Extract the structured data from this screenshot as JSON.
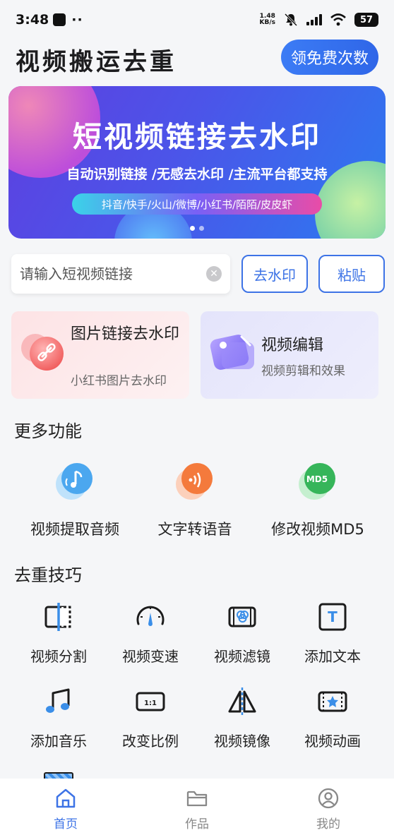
{
  "status_bar": {
    "time": "3:48",
    "dots": "··",
    "net_speed_top": "1.48",
    "net_speed_bottom": "KB/s",
    "battery": "57"
  },
  "header": {
    "title": "视频搬运去重",
    "free_button": "领免费次数"
  },
  "banner": {
    "title": "短视频链接去水印",
    "subtitle": "自动识别链接 /无感去水印 /主流平台都支持",
    "platforms": "抖音/快手/火山/微博/小红书/陌陌/皮皮虾",
    "active_dot": 1
  },
  "search": {
    "placeholder": "请输入短视频链接",
    "value": "",
    "dewater_button": "去水印",
    "paste_button": "粘贴"
  },
  "cards": [
    {
      "title": "图片链接去水印",
      "subtitle": "小红书图片去水印",
      "icon": "link-icon"
    },
    {
      "title": "视频编辑",
      "subtitle": "视频剪辑和效果",
      "icon": "video-edit-icon"
    }
  ],
  "more_functions": {
    "title": "更多功能",
    "items": [
      {
        "label": "视频提取音频",
        "icon": "music-extract-icon"
      },
      {
        "label": "文字转语音",
        "icon": "sound-wave-icon"
      },
      {
        "label": "修改视频MD5",
        "icon": "md5-icon",
        "icon_text": "MD5"
      }
    ]
  },
  "tips": {
    "title": "去重技巧",
    "items": [
      {
        "label": "视频分割",
        "icon": "split-icon"
      },
      {
        "label": "视频变速",
        "icon": "speed-icon"
      },
      {
        "label": "视频滤镜",
        "icon": "filter-icon"
      },
      {
        "label": "添加文本",
        "icon": "text-icon",
        "icon_text": "T"
      },
      {
        "label": "添加音乐",
        "icon": "music-note-icon"
      },
      {
        "label": "改变比例",
        "icon": "ratio-icon",
        "icon_text": "1:1"
      },
      {
        "label": "视频镜像",
        "icon": "mirror-icon"
      },
      {
        "label": "视频动画",
        "icon": "animation-icon"
      }
    ]
  },
  "bottom_nav": [
    {
      "label": "首页",
      "icon": "home-icon",
      "active": true
    },
    {
      "label": "作品",
      "icon": "folder-icon",
      "active": false
    },
    {
      "label": "我的",
      "icon": "profile-icon",
      "active": false
    }
  ],
  "colors": {
    "accent": "#3d73e6",
    "background": "#f5f6f8",
    "pink_card": "#fde3e5",
    "purple_card": "#e4e4fb"
  }
}
